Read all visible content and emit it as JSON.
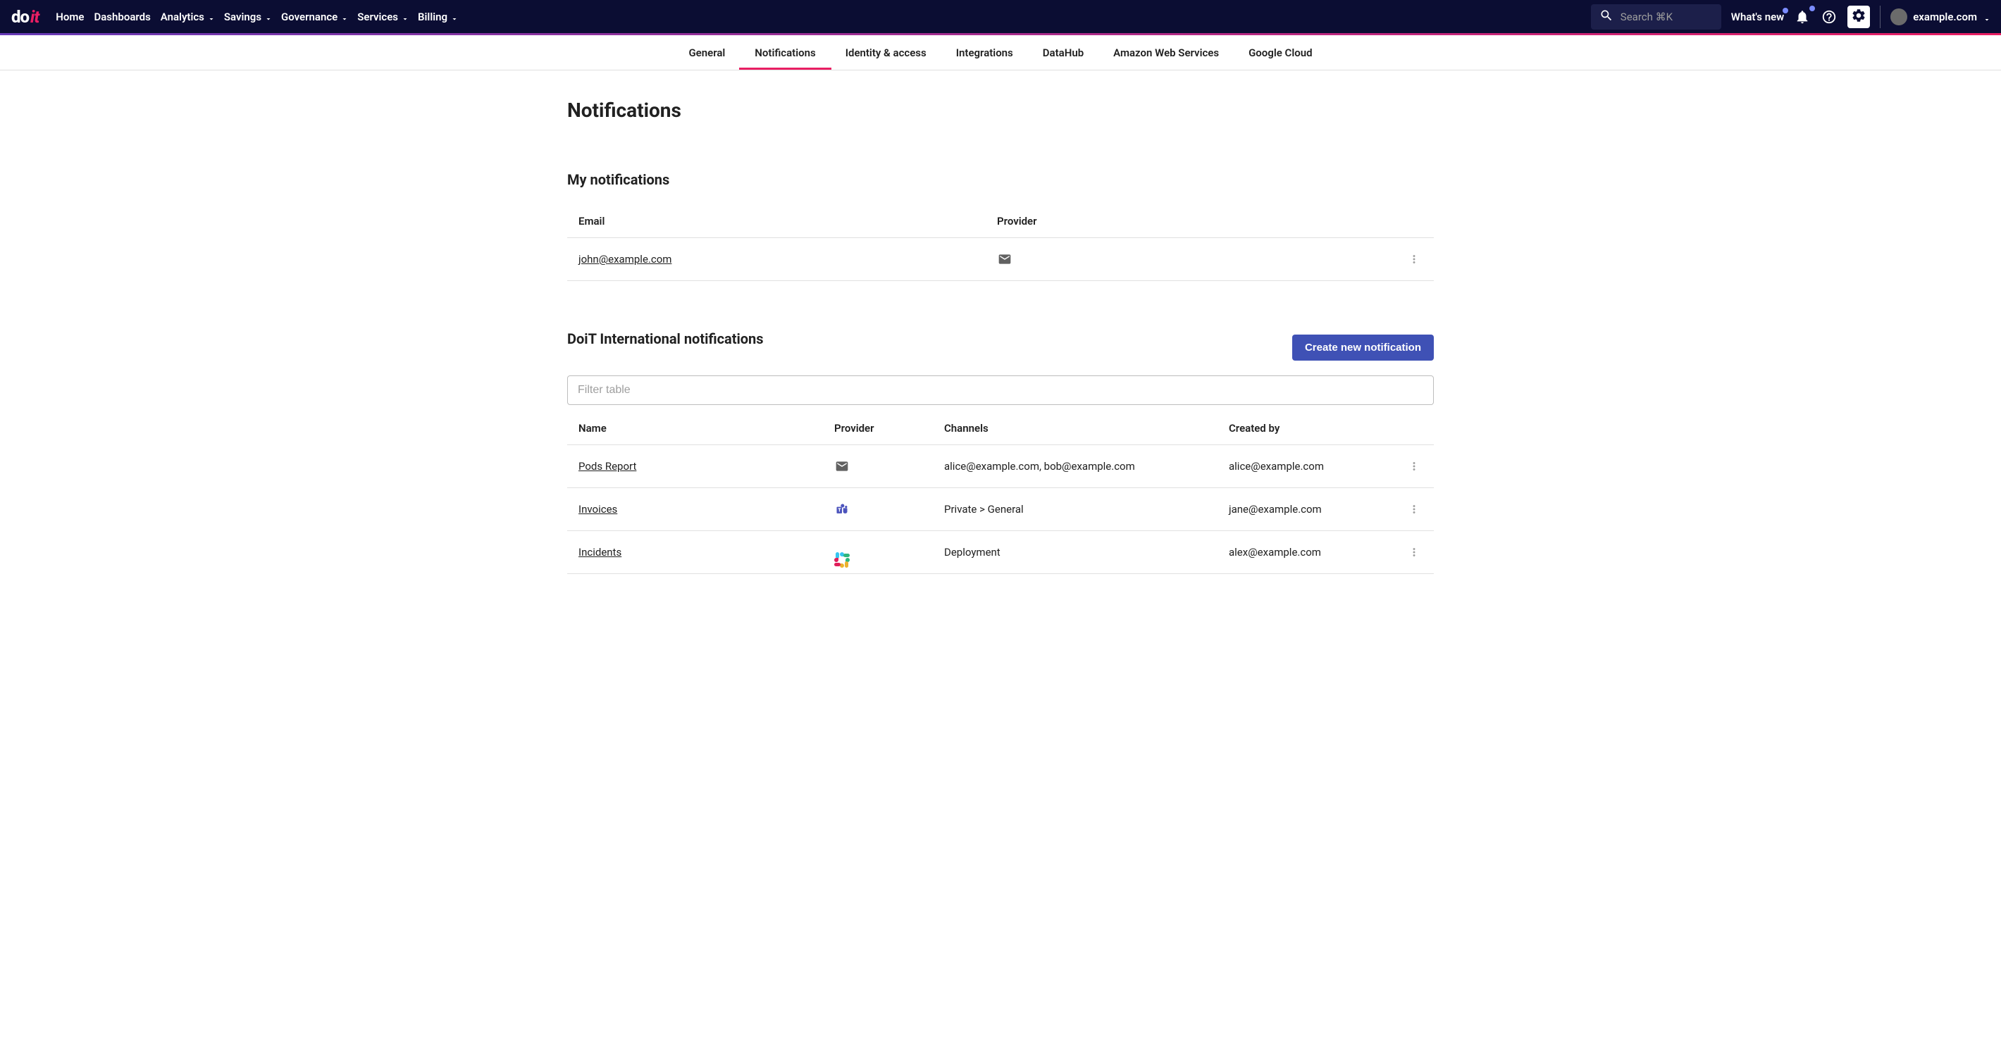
{
  "topbar": {
    "nav": [
      "Home",
      "Dashboards",
      "Analytics",
      "Savings",
      "Governance",
      "Services",
      "Billing"
    ],
    "nav_has_dropdown": [
      false,
      false,
      true,
      true,
      true,
      true,
      true
    ],
    "search_placeholder": "Search ⌘K",
    "whats_new": "What's new",
    "username": "example.com"
  },
  "subnav": {
    "items": [
      "General",
      "Notifications",
      "Identity & access",
      "Integrations",
      "DataHub",
      "Amazon Web Services",
      "Google Cloud"
    ],
    "active_index": 1
  },
  "page_title": "Notifications",
  "my_notifications": {
    "title": "My notifications",
    "headers": [
      "Email",
      "Provider"
    ],
    "rows": [
      {
        "email": "john@example.com",
        "provider": "email"
      }
    ]
  },
  "org_notifications": {
    "title": "DoiT International notifications",
    "create_button": "Create new notification",
    "filter_placeholder": "Filter table",
    "headers": [
      "Name",
      "Provider",
      "Channels",
      "Created by"
    ],
    "rows": [
      {
        "name": "Pods Report",
        "provider": "email",
        "channels": "alice@example.com, bob@example.com",
        "created_by": "alice@example.com"
      },
      {
        "name": "Invoices",
        "provider": "teams",
        "channels": "Private > General",
        "created_by": "jane@example.com"
      },
      {
        "name": "Incidents",
        "provider": "slack",
        "channels": "Deployment",
        "created_by": "alex@example.com"
      }
    ]
  }
}
